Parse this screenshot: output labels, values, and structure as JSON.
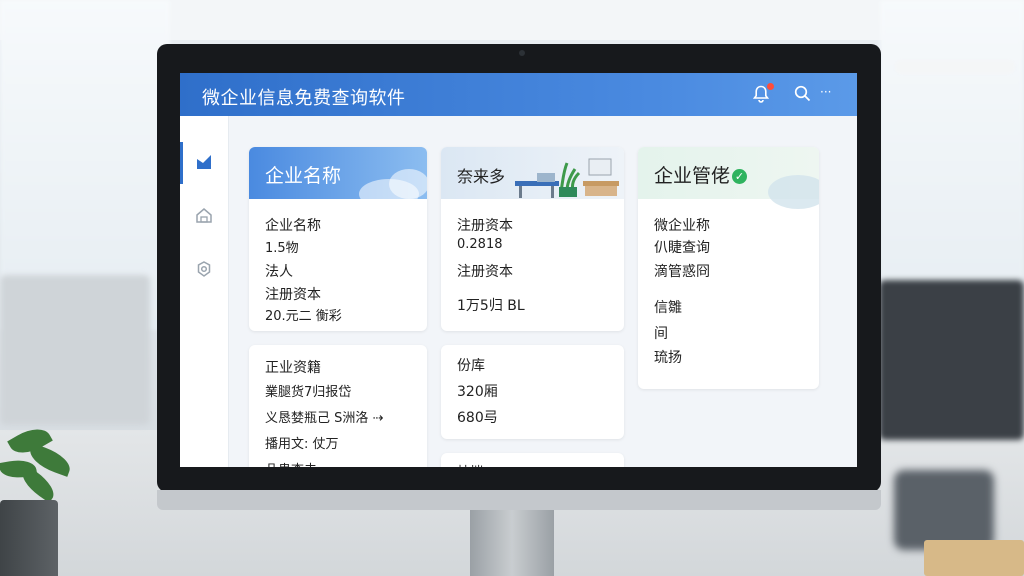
{
  "app": {
    "title": "微企业信息免费查询软件"
  },
  "titlebar": {
    "bell_icon": "bell-icon",
    "search_icon": "search-icon",
    "more_icon": "more-icon",
    "more_label": "···"
  },
  "sidebar": {
    "items": [
      {
        "icon": "chart-icon",
        "active": true
      },
      {
        "icon": "home-icon",
        "active": false
      },
      {
        "icon": "settings-icon",
        "active": false
      }
    ]
  },
  "cards": {
    "card1": {
      "title": "企业名称",
      "lines": [
        "企业名称",
        "1.5物",
        "法人",
        "注册资本",
        "20.元二    衡彩"
      ]
    },
    "card2": {
      "title": "奈来多",
      "lines": [
        "注册资本",
        "0.2818",
        "注册资本",
        "1万5归 BL"
      ]
    },
    "card3": {
      "title": "企业管佬",
      "lines": [
        "微企业称",
        "仈睫查询",
        "滴管惑冏",
        "信雛",
        "间",
        "琉扬"
      ]
    },
    "card4": {
      "lines": [
        "正业资籍",
        "業腿货7归报岱",
        "义恳婪瓶己 S洲洛 ⇢",
        "播用文: 仗万",
        "卩蛊杏去"
      ]
    },
    "card5": {
      "lines": [
        "份库",
        "320厢",
        "680㢧"
      ]
    },
    "card6": {
      "lines": [
        "㭑墔"
      ]
    }
  },
  "colors": {
    "accent": "#2f6fca",
    "notification": "#ff4d3a",
    "verified": "#2fb35f"
  }
}
